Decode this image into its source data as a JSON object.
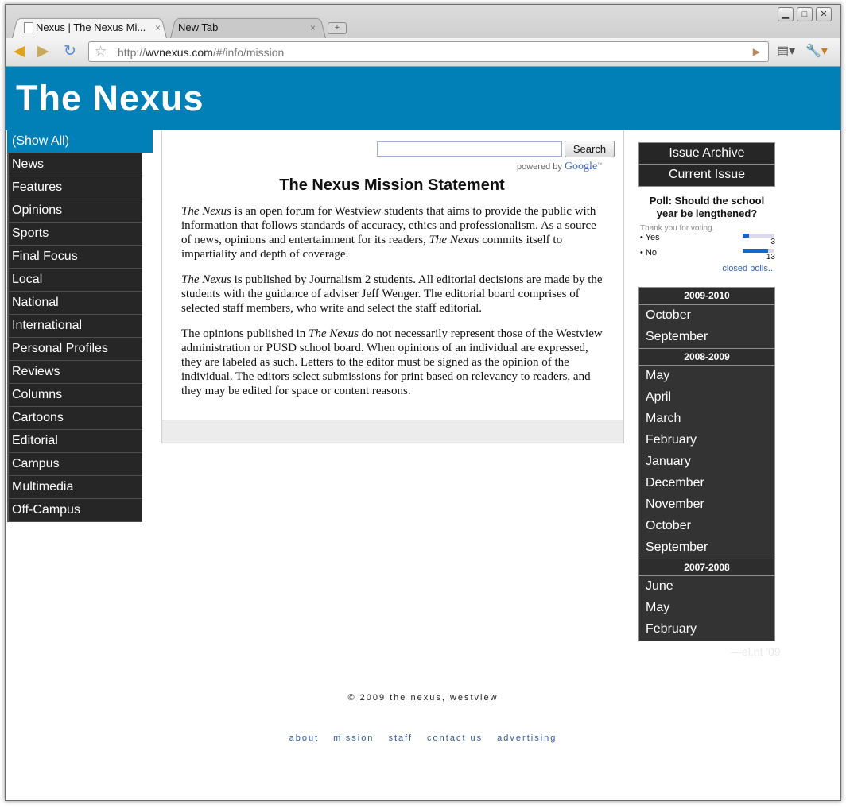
{
  "browser": {
    "tabs": [
      {
        "label": "Nexus | The Nexus Mi...",
        "close": "×"
      },
      {
        "label": "New Tab",
        "close": "×"
      }
    ],
    "new_tab": "+",
    "url_scheme": "http://",
    "url_host": "wvnexus.com",
    "url_path": "/#/info/mission",
    "icons": [
      "back-icon",
      "forward-icon",
      "reload-icon",
      "star-icon",
      "go-icon",
      "page-menu-icon",
      "wrench-icon",
      "minimize-icon",
      "maximize-icon",
      "close-icon"
    ]
  },
  "site": {
    "title": "The Nexus",
    "show_all": "(Show All)",
    "nav": [
      "News",
      "Features",
      "Opinions",
      "Sports",
      "Final Focus",
      "Local",
      "National",
      "International",
      "Personal Profiles",
      "Reviews",
      "Columns",
      "Cartoons",
      "Editorial",
      "Campus",
      "Multimedia",
      "Off-Campus"
    ]
  },
  "main": {
    "search_value": "",
    "search_button": "Search",
    "powered_by": "powered by",
    "powered_brand": "Google",
    "heading": "The Nexus Mission Statement",
    "paragraphs": [
      {
        "em": "The Nexus",
        "text": " is an open forum for Westview students that aims to provide the public with information that follows standards of accuracy, ethics and professionalism. As a source of news, opinions and entertainment for its readers, ",
        "em2": "The Nexus",
        "text2": " commits itself to impartiality and depth of coverage."
      },
      {
        "em": "The Nexus",
        "text": " is published by Journalism 2 students. All editorial decisions are made by the students with the guidance of adviser Jeff Wenger. The editorial board comprises of selected staff members, who write and select the staff editorial."
      },
      {
        "pre": "The opinions published in ",
        "em": "The Nexus",
        "text": " do not necessarily represent those of the Westview administration or PUSD school board. When opinions of an individual are expressed, they are labeled as such. Letters to the editor must be signed as the opinion of the individual. The editors select submissions for print based on relevancy to readers, and they may be edited for space or content reasons."
      }
    ]
  },
  "sidebar": {
    "issue_archive": "Issue Archive",
    "current_issue": "Current Issue",
    "poll": {
      "question": "Poll: Should the school year be lengthened?",
      "thanks": "Thank you for voting.",
      "options": [
        {
          "label": "Yes",
          "count": "3",
          "share": 0.19
        },
        {
          "label": "No",
          "count": "13",
          "share": 0.81
        }
      ],
      "closed_link": "closed polls..."
    },
    "archive": [
      {
        "year": "2009-2010",
        "months": [
          "October",
          "September"
        ]
      },
      {
        "year": "2008-2009",
        "months": [
          "May",
          "April",
          "March",
          "February",
          "January",
          "December",
          "November",
          "October",
          "September"
        ]
      },
      {
        "year": "2007-2008",
        "months": [
          "June",
          "May",
          "February"
        ]
      }
    ],
    "credit": "—el.nt '09"
  },
  "footer": {
    "copyright": "© 2009 the nexus, westview",
    "links": [
      "about",
      "mission",
      "staff",
      "contact us",
      "advertising"
    ]
  }
}
